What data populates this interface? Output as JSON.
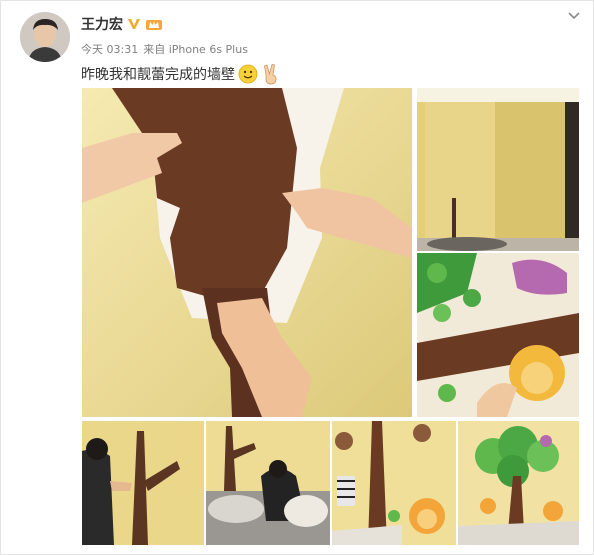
{
  "post": {
    "author": "王力宏",
    "time": "今天 03:31",
    "source": "来自 iPhone 6s Plus",
    "text": "昨晚我和靓蕾完成的墙壁",
    "emoji_smile": "smile-emoji",
    "emoji_victory": "victory-hand-emoji"
  },
  "icons": {
    "verified": "verified-v-icon",
    "vip": "vip-crown-icon",
    "menu": "chevron-down-icon"
  },
  "colors": {
    "verified": "#f5a623",
    "wall_yellow": "#f0e09a",
    "cutout_brown": "#6b3a23"
  },
  "photos": [
    {
      "id": "main",
      "description": "hands pressing brown tree trunk sticker on yellow wall"
    },
    {
      "id": "corner",
      "description": "empty room corner with yellow walls"
    },
    {
      "id": "closeup",
      "description": "colorful tree and lion decal close-up"
    },
    {
      "id": "thumb1",
      "description": "man applying tree sticker"
    },
    {
      "id": "thumb2",
      "description": "man working on floor near tree decal"
    },
    {
      "id": "thumb3",
      "description": "wall with monkeys, zebra and lion decals"
    },
    {
      "id": "thumb4",
      "description": "finished tree wall mural with animals"
    }
  ]
}
